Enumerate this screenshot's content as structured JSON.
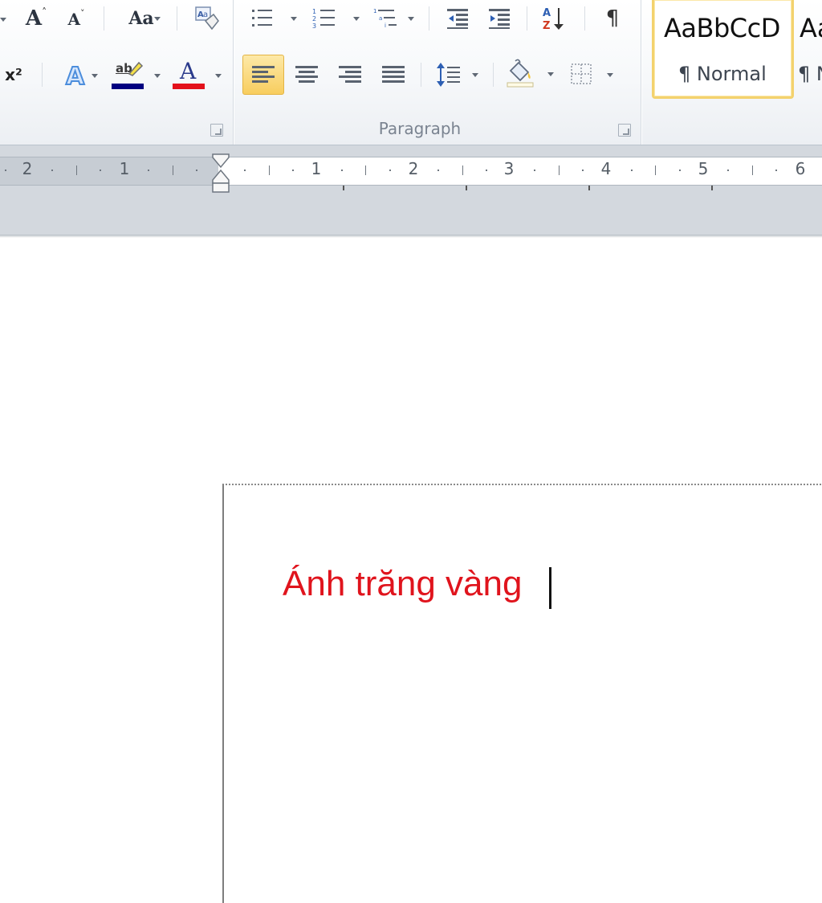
{
  "ribbon": {
    "font_group": {
      "grow_font_icon": "grow-font",
      "shrink_font_icon": "shrink-font",
      "change_case_label": "Aa",
      "clear_format_icon": "clear-formatting",
      "superscript_label": "x²",
      "text_effects_label": "A",
      "highlight_label": "ab",
      "highlight_color": "#000080",
      "font_color_label": "A",
      "font_color": "#e3111b"
    },
    "paragraph_group": {
      "label": "Paragraph",
      "show_marks_label": "¶"
    },
    "styles_group": {
      "style1_preview": "AaBbCcD",
      "style1_name": "¶ Normal",
      "style2_preview": "Aa",
      "style2_name": "¶ N"
    }
  },
  "ruler": {
    "left_numbers": [
      "2",
      "1"
    ],
    "right_numbers": [
      "1",
      "2",
      "3",
      "4",
      "5",
      "6"
    ]
  },
  "document": {
    "text": "Ánh trăng vàng",
    "text_color": "#e0141d"
  }
}
